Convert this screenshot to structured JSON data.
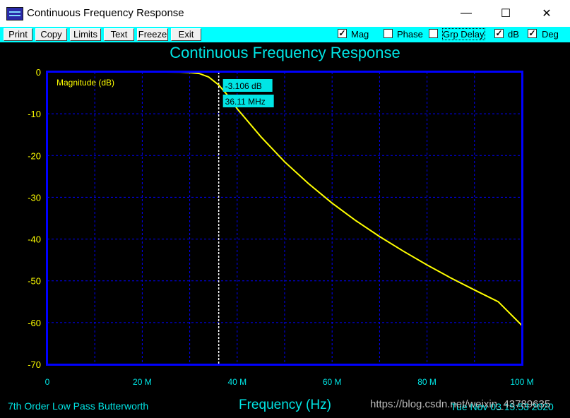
{
  "window": {
    "title": "Continuous Frequency Response",
    "minimize": "—",
    "maximize": "☐",
    "close": "✕"
  },
  "toolbar": {
    "buttons": [
      "Print",
      "Copy",
      "Limits",
      "Text",
      "Freeze",
      "Exit"
    ],
    "checkboxes": [
      {
        "label": "Mag",
        "checked": true
      },
      {
        "label": "Phase",
        "checked": false
      },
      {
        "label": "Grp Delay",
        "checked": false
      },
      {
        "label": "dB",
        "checked": true
      },
      {
        "label": "Deg",
        "checked": true
      }
    ]
  },
  "chart_data": {
    "type": "line",
    "title": "Continuous Frequency Response",
    "xlabel": "Frequency (Hz)",
    "ylabel": "",
    "xlim": [
      0,
      100
    ],
    "ylim": [
      -70,
      0
    ],
    "x_ticks": [
      "0",
      "20 M",
      "40 M",
      "60 M",
      "80 M",
      "100 M"
    ],
    "y_ticks": [
      "0",
      "-10",
      "-20",
      "-30",
      "-40",
      "-50",
      "-60",
      "-70"
    ],
    "grid": true,
    "series": [
      {
        "name": "Magnitude (dB)",
        "color": "#ffff00",
        "x_unit": "MHz",
        "x": [
          0,
          10,
          20,
          25,
          28,
          30,
          32,
          34,
          36.11,
          38,
          40,
          45,
          50,
          55,
          60,
          65,
          70,
          75,
          80,
          85,
          90,
          95,
          100
        ],
        "y": [
          0,
          0,
          0,
          0,
          -0.02,
          -0.11,
          -0.35,
          -1.2,
          -3.106,
          -5.6,
          -8.8,
          -15.5,
          -21.5,
          -26.7,
          -31.4,
          -35.6,
          -39.4,
          -42.9,
          -46.2,
          -49.3,
          -52.2,
          -55.0,
          -60.7
        ]
      }
    ],
    "cursor": {
      "x": 36.11,
      "y_label": "-3.106 dB",
      "x_label": "36.11 MHz"
    }
  },
  "footer": {
    "filter_type": "7th Order Low Pass Butterworth",
    "date": "Tue Nov 03 15:53 2020",
    "watermark": "https://blog.csdn.net/weixin_43789635"
  }
}
